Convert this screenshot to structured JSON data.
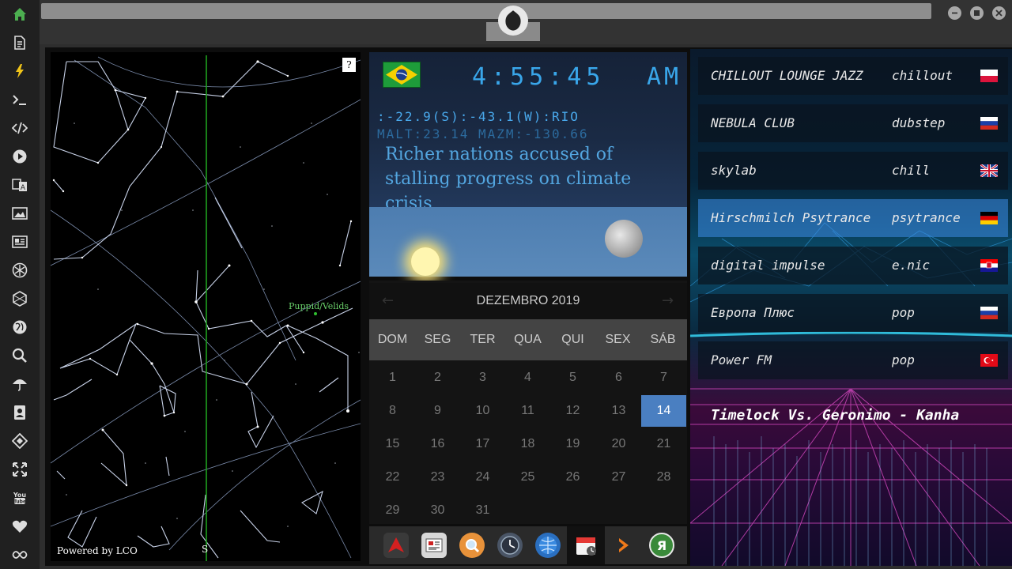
{
  "sidebar": {
    "items": [
      {
        "name": "home-icon",
        "color": "#4caf50"
      },
      {
        "name": "document-icon"
      },
      {
        "name": "lightning-icon",
        "color": "#f0c419"
      },
      {
        "name": "terminal-icon"
      },
      {
        "name": "code-icon"
      },
      {
        "name": "play-icon"
      },
      {
        "name": "translate-icon"
      },
      {
        "name": "image-icon"
      },
      {
        "name": "news-icon"
      },
      {
        "name": "rebel-icon"
      },
      {
        "name": "hexagon-icon"
      },
      {
        "name": "globe-icon"
      },
      {
        "name": "search-icon"
      },
      {
        "name": "umbrella-icon"
      },
      {
        "name": "contact-icon"
      },
      {
        "name": "diamond-icon"
      },
      {
        "name": "expand-icon"
      },
      {
        "name": "youtube-icon"
      },
      {
        "name": "heart-icon"
      },
      {
        "name": "infinity-icon"
      }
    ]
  },
  "skymap": {
    "help_label": "?",
    "constellation_label": "Puppid/Velids",
    "powered_by": "Powered by LCO",
    "south_label": "S"
  },
  "clock": {
    "time": "4:55:45",
    "ampm": "AM",
    "coords": ":-22.9(S):-43.1(W):RIO",
    "malt": "MALT:23.14 MAZM:-130.66",
    "headline": "Richer nations accused of stalling progress on climate crisis"
  },
  "calendar": {
    "title": "DEZEMBRO 2019",
    "prev_arrow": "←",
    "next_arrow": "→",
    "weekdays": [
      "DOM",
      "SEG",
      "TER",
      "QUA",
      "QUI",
      "SEX",
      "SÁB"
    ],
    "days": [
      "1",
      "2",
      "3",
      "4",
      "5",
      "6",
      "7",
      "8",
      "9",
      "10",
      "11",
      "12",
      "13",
      "14",
      "15",
      "16",
      "17",
      "18",
      "19",
      "20",
      "21",
      "22",
      "23",
      "24",
      "25",
      "26",
      "27",
      "28",
      "29",
      "30",
      "31"
    ],
    "selected_day": "14",
    "accent": "#4a7fc1"
  },
  "dock": {
    "apps": [
      {
        "name": "arch-app-icon"
      },
      {
        "name": "news-app-icon"
      },
      {
        "name": "search-app-icon"
      },
      {
        "name": "clock-app-icon"
      },
      {
        "name": "globe-app-icon"
      },
      {
        "name": "calendar-app-icon"
      },
      {
        "name": "forward-app-icon"
      },
      {
        "name": "yandex-app-icon",
        "label": "Я"
      }
    ]
  },
  "radio": {
    "stations": [
      {
        "name": "CHILLOUT LOUNGE JAZZ",
        "genre": "chillout",
        "flag": "poland-flag"
      },
      {
        "name": "NEBULA CLUB",
        "genre": "dubstep",
        "flag": "russia-flag"
      },
      {
        "name": "skylab",
        "genre": "chill",
        "flag": "uk-flag"
      },
      {
        "name": "Hirschmilch Psytrance",
        "genre": "psytrance",
        "flag": "germany-flag",
        "active": true
      },
      {
        "name": "digital impulse",
        "genre": "e.nic",
        "flag": "croatia-flag"
      },
      {
        "name": "Европа Плюс",
        "genre": "pop",
        "flag": "russia-flag"
      },
      {
        "name": "Power FM",
        "genre": "pop",
        "flag": "turkey-flag"
      }
    ],
    "now_playing": "Timelock Vs. Geronimo - Kanha",
    "active_color": "#3c8ce6"
  }
}
